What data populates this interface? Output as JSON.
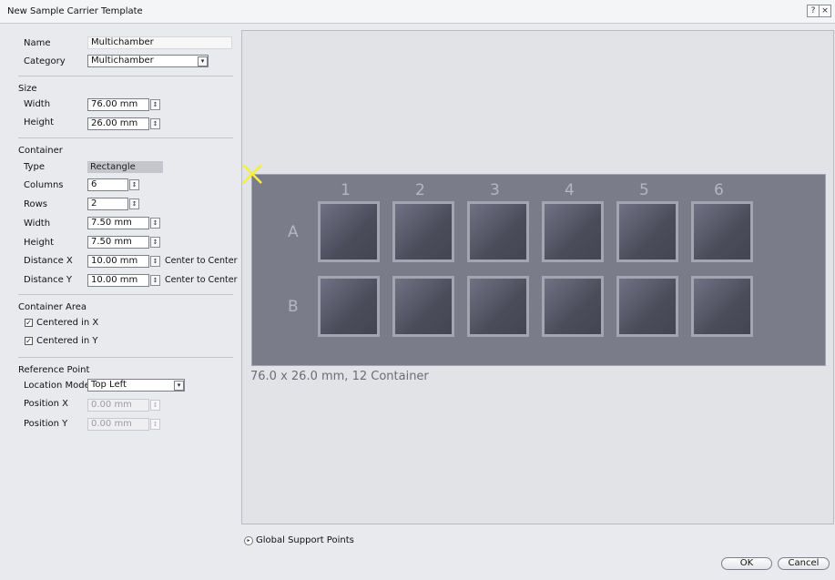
{
  "window": {
    "title": "New Sample Carrier Template",
    "help_glyph": "?",
    "close_glyph": "×"
  },
  "form": {
    "name_label": "Name",
    "name_value": "Multichamber",
    "category_label": "Category",
    "category_value": "Multichamber",
    "size_section": "Size",
    "width_label": "Width",
    "width_value": "76.00 mm",
    "height_label": "Height",
    "height_value": "26.00 mm",
    "container_section": "Container",
    "type_label": "Type",
    "type_value": "Rectangle",
    "columns_label": "Columns",
    "columns_value": "6",
    "rows_label": "Rows",
    "rows_value": "2",
    "c_width_label": "Width",
    "c_width_value": "7.50 mm",
    "c_height_label": "Height",
    "c_height_value": "7.50 mm",
    "distx_label": "Distance X",
    "distx_value": "10.00 mm",
    "distx_suffix": "Center to Center",
    "disty_label": "Distance Y",
    "disty_value": "10.00 mm",
    "disty_suffix": "Center to Center",
    "area_section": "Container Area",
    "centered_x_label": "Centered in X",
    "centered_x_checked": true,
    "centered_y_label": "Centered in Y",
    "centered_y_checked": true,
    "ref_section": "Reference Point",
    "location_mode_label": "Location Mode",
    "location_mode_value": "Top Left",
    "posx_label": "Position X",
    "posx_value": "0.00 mm",
    "posy_label": "Position Y",
    "posy_value": "0.00 mm"
  },
  "preview": {
    "columns": [
      "1",
      "2",
      "3",
      "4",
      "5",
      "6"
    ],
    "rows": [
      "A",
      "B"
    ],
    "summary": "76.0 x 26.0 mm, 12 Container",
    "marker_color": "#f5f03a"
  },
  "footer": {
    "support_points_label": "Global Support Points",
    "ok_label": "OK",
    "cancel_label": "Cancel"
  },
  "icons": {
    "spin": "↕",
    "dropdown": "▾",
    "check": "✓",
    "expand": "▸"
  }
}
